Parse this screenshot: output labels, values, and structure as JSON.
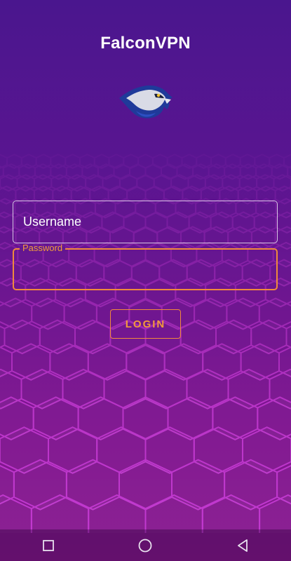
{
  "app": {
    "title": "FalconVPN"
  },
  "form": {
    "username_placeholder": "Username",
    "password_label": "Password",
    "login_label": "LOGIN"
  },
  "colors": {
    "accent": "#f08a3c",
    "background_top": "#4a168e",
    "background_bottom": "#8a1a90",
    "hex_lines": "#c23ad0"
  },
  "icons": {
    "logo": "falcon-logo-icon",
    "nav_recents": "square-icon",
    "nav_home": "circle-icon",
    "nav_back": "triangle-back-icon"
  }
}
